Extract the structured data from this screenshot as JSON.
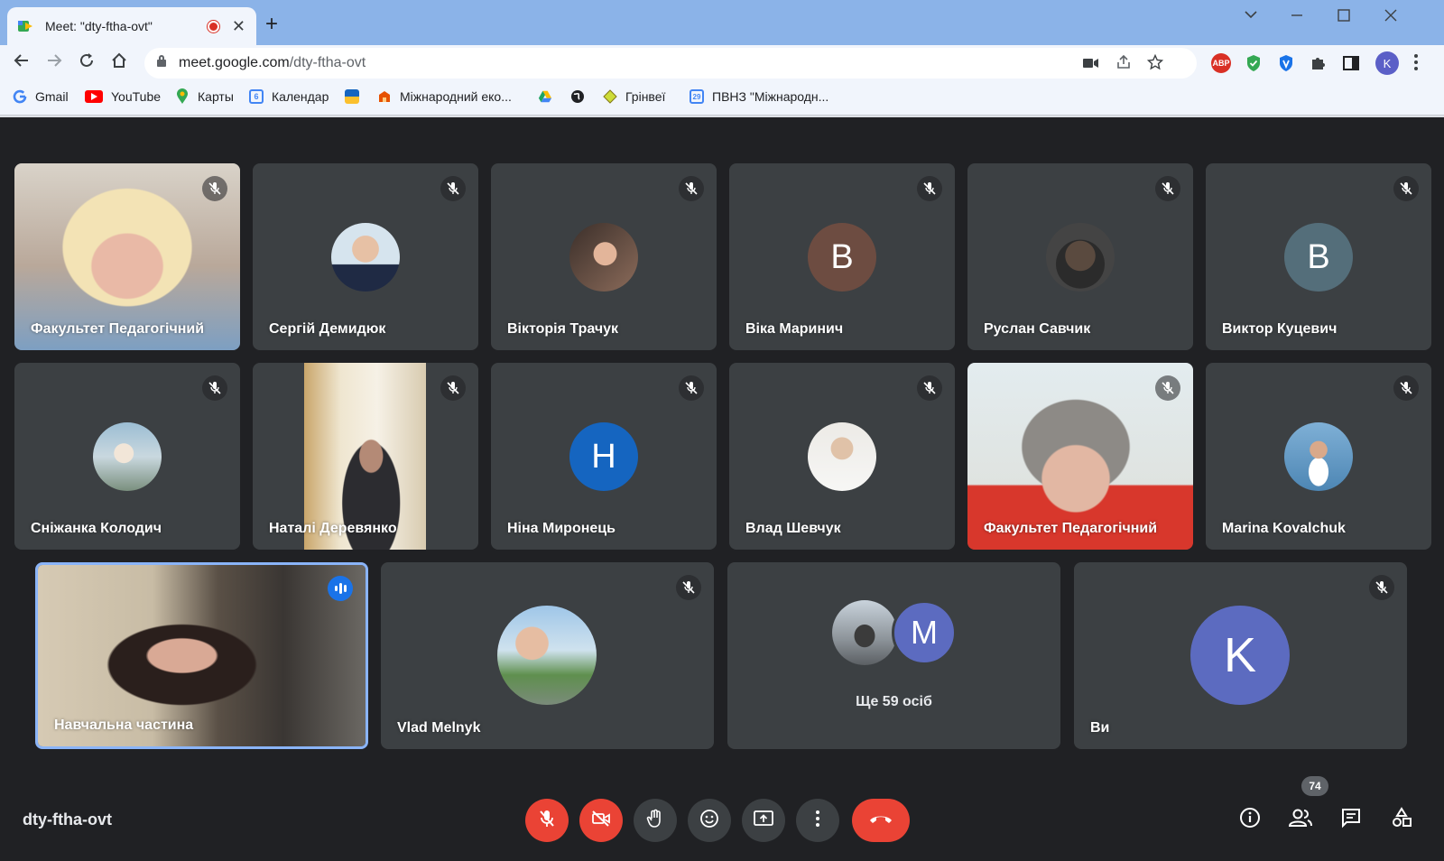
{
  "browser": {
    "tab_title": "Meet: \"dty-ftha-ovt\"",
    "url_domain": "meet.google.com",
    "url_path": "/dty-ftha-ovt",
    "profile_initial": "K",
    "abp_label": "ABP",
    "bookmarks": [
      {
        "label": "Gmail",
        "icon": "google-icon"
      },
      {
        "label": "YouTube",
        "icon": "youtube-icon"
      },
      {
        "label": "Карты",
        "icon": "maps-icon"
      },
      {
        "label": "Календар",
        "icon": "calendar-icon",
        "icon_text": "6"
      },
      {
        "label": "",
        "icon": "flag-icon"
      },
      {
        "label": "Міжнародний еко...",
        "icon": "site-icon"
      },
      {
        "label": "",
        "icon": "drive-icon"
      },
      {
        "label": "",
        "icon": "globe-icon"
      },
      {
        "label": "Грінвеї",
        "icon": "greenway-icon"
      },
      {
        "label": "ПВНЗ \"Міжнародн...",
        "icon": "calendar-icon",
        "icon_text": "29"
      }
    ]
  },
  "participants": [
    {
      "name": "Факультет Педагогічний",
      "type": "video",
      "muted": true
    },
    {
      "name": "Сергій Демидюк",
      "type": "photo",
      "muted": true
    },
    {
      "name": "Вікторія Трачук",
      "type": "photo",
      "muted": true
    },
    {
      "name": "Віка Маринич",
      "type": "letter",
      "letter": "В",
      "color": "#6d4c41",
      "muted": true
    },
    {
      "name": "Руслан Савчик",
      "type": "photo",
      "muted": true
    },
    {
      "name": "Виктор Куцевич",
      "type": "letter",
      "letter": "В",
      "color": "#546e7a",
      "muted": true
    },
    {
      "name": "Сніжанка Колодич",
      "type": "photo",
      "muted": true
    },
    {
      "name": "Наталі Деревянко",
      "type": "video",
      "muted": true
    },
    {
      "name": "Ніна Миронець",
      "type": "letter",
      "letter": "Н",
      "color": "#1565c0",
      "muted": true
    },
    {
      "name": "Влад Шевчук",
      "type": "photo",
      "muted": true
    },
    {
      "name": "Факультет Педагогічний",
      "type": "video",
      "muted": true
    },
    {
      "name": "Marina Kovalchuk",
      "type": "photo",
      "muted": true
    },
    {
      "name": "Навчальна частина",
      "type": "video",
      "muted": false,
      "speaking": true
    },
    {
      "name": "Vlad Melnyk",
      "type": "photo",
      "muted": true
    }
  ],
  "others_tile": {
    "label": "Ще 59 осіб",
    "letter": "M",
    "color": "#5c6bc0"
  },
  "self_tile": {
    "name": "Ви",
    "letter": "K",
    "color": "#5c6bc0",
    "muted": true
  },
  "bottom_bar": {
    "meeting_code": "dty-ftha-ovt",
    "participant_count": "74",
    "controls": [
      "mic-off-icon",
      "camera-off-icon",
      "raise-hand-icon",
      "emoji-icon",
      "present-icon",
      "more-icon",
      "end-call-icon"
    ],
    "right_controls": [
      "info-icon",
      "people-icon",
      "chat-icon",
      "activities-icon"
    ]
  },
  "colors": {
    "background": "#202124",
    "tile": "#3c4043",
    "red": "#ea4335",
    "blue": "#1a73e8"
  }
}
